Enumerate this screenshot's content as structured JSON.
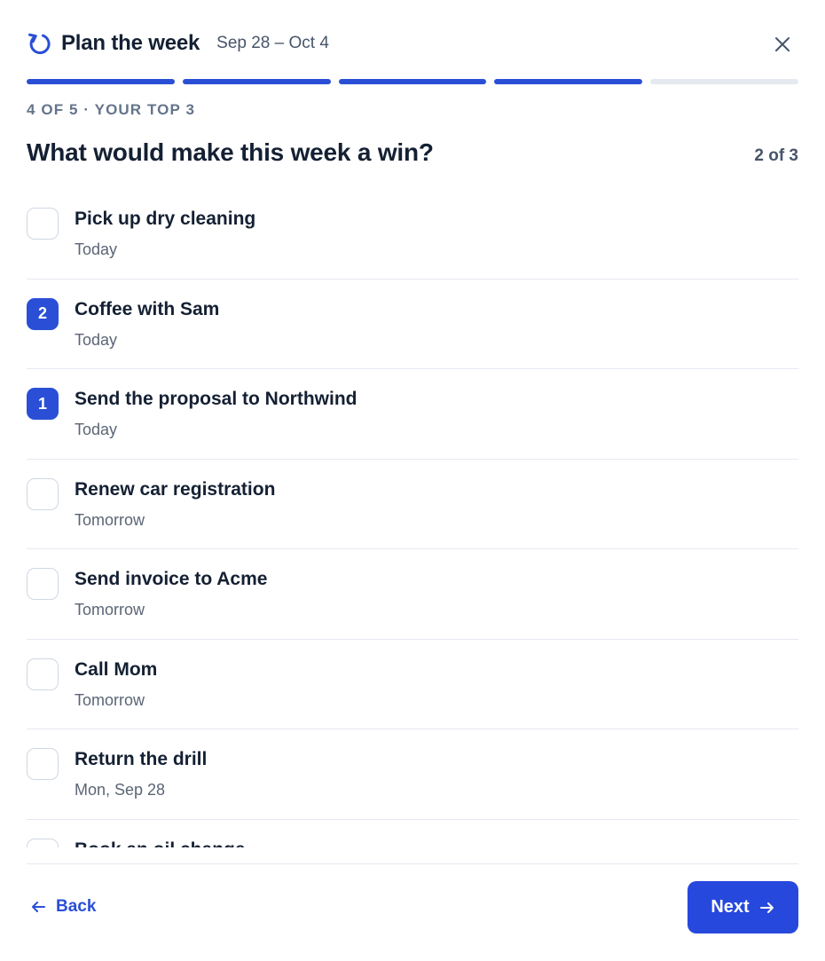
{
  "header": {
    "title": "Plan the week",
    "date_range": "Sep 28 – Oct 4",
    "icon": "refresh-icon",
    "close_icon": "close-icon"
  },
  "progress": {
    "total_steps": 5,
    "current_step": 4
  },
  "step_label": "4 OF 5 · YOUR TOP 3",
  "question": "What would make this week a win?",
  "pick_count": "2 of 3",
  "tasks": [
    {
      "title": "Pick up dry cleaning",
      "due": "Today",
      "rank": ""
    },
    {
      "title": "Coffee with Sam",
      "due": "Today",
      "rank": "2"
    },
    {
      "title": "Send the proposal to Northwind",
      "due": "Today",
      "rank": "1"
    },
    {
      "title": "Renew car registration",
      "due": "Tomorrow",
      "rank": ""
    },
    {
      "title": "Send invoice to Acme",
      "due": "Tomorrow",
      "rank": ""
    },
    {
      "title": "Call Mom",
      "due": "Tomorrow",
      "rank": ""
    },
    {
      "title": "Return the drill",
      "due": "Mon, Sep 28",
      "rank": ""
    },
    {
      "title": "Book an oil change",
      "due": "",
      "rank": ""
    }
  ],
  "footer": {
    "back_label": "Back",
    "next_label": "Next"
  },
  "colors": {
    "accent": "#2a4fd6",
    "button": "#2748dd",
    "text": "#142033",
    "muted": "#5b6575",
    "track": "#e5e9f0"
  }
}
